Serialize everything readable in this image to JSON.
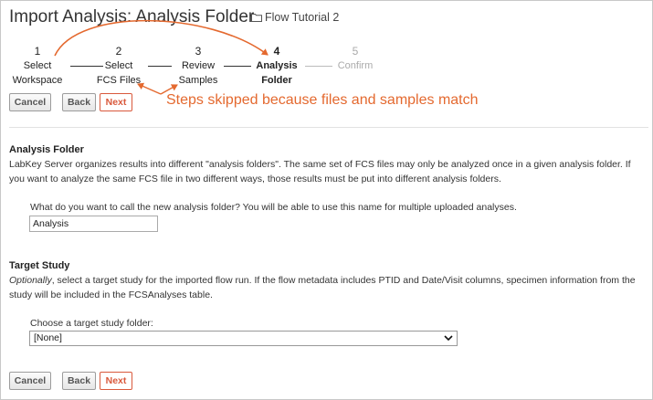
{
  "header": {
    "title": "Import Analysis: Analysis Folder",
    "folder_name": "Flow Tutorial 2"
  },
  "wizard": {
    "steps": [
      {
        "number": "1",
        "line1": "Select",
        "line2": "Workspace",
        "state": "done"
      },
      {
        "number": "2",
        "line1": "Select",
        "line2": "FCS Files",
        "state": "done"
      },
      {
        "number": "3",
        "line1": "Review",
        "line2": "Samples",
        "state": "done"
      },
      {
        "number": "4",
        "line1": "Analysis",
        "line2": "Folder",
        "state": "current"
      },
      {
        "number": "5",
        "line1": "Confirm",
        "line2": "",
        "state": "future"
      }
    ]
  },
  "annotation": {
    "text": "Steps skipped because files and samples match",
    "color": "#e4692f"
  },
  "buttons": {
    "cancel": "Cancel",
    "back": "Back",
    "next": "Next"
  },
  "analysis_folder": {
    "heading": "Analysis Folder",
    "description": "LabKey Server organizes results into different \"analysis folders\". The same set of FCS files may only be analyzed once in a given analysis folder. If you want to analyze the same FCS file in two different ways, those results must be put into different analysis folders.",
    "prompt": "What do you want to call the new analysis folder? You will be able to use this name for multiple uploaded analyses.",
    "value": "Analysis"
  },
  "target_study": {
    "heading": "Target Study",
    "description_em": "Optionally",
    "description_rest": ", select a target study for the imported flow run. If the flow metadata includes PTID and Date/Visit columns, specimen information from the study will be included in the FCSAnalyses table.",
    "prompt": "Choose a target study folder:",
    "selected": "[None]"
  },
  "colors": {
    "accent": "#d9593c",
    "annotation": "#e4692f"
  }
}
